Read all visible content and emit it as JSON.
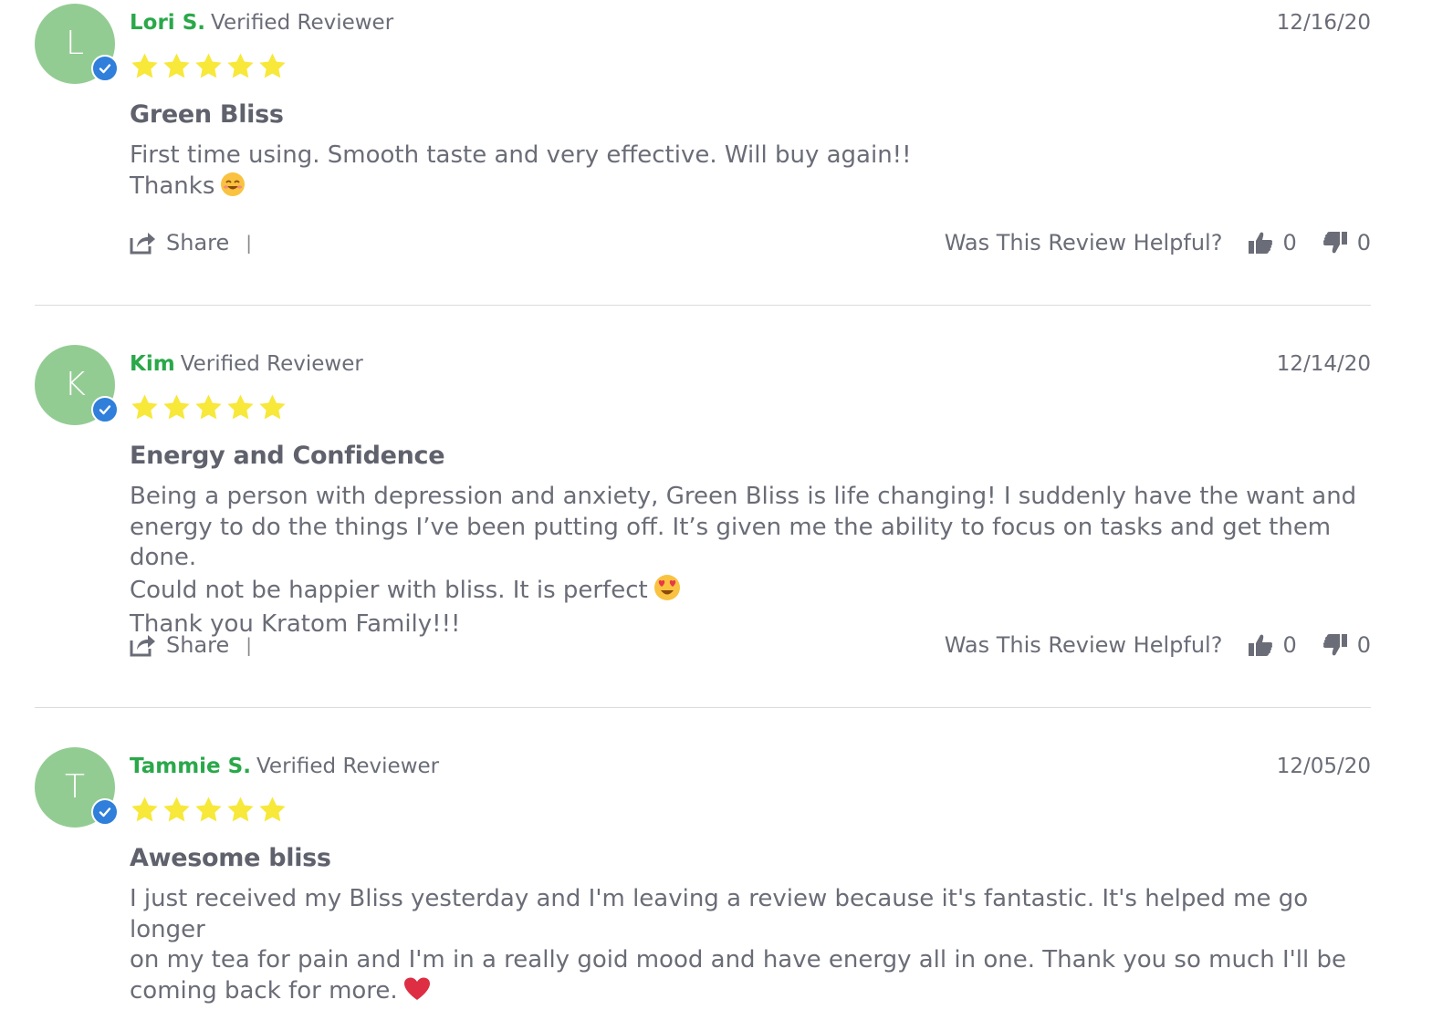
{
  "reviews": [
    {
      "initial": "L",
      "name": "Lori S.",
      "badge": "Verified Reviewer",
      "date": "12/16/20",
      "rating": 5,
      "title": "Green Bliss",
      "body_lines": [
        "First time using. Smooth taste and very effective. Will buy again!!",
        "Thanks"
      ],
      "emoji": "smiling-face-emoji",
      "share_label": "Share",
      "helpful_label": "Was This Review Helpful?",
      "up_count": "0",
      "down_count": "0"
    },
    {
      "initial": "K",
      "name": "Kim",
      "badge": "Verified Reviewer",
      "date": "12/14/20",
      "rating": 5,
      "title": "Energy and Confidence",
      "body_lines": [
        "Being a person with depression and anxiety, Green Bliss is life changing! I suddenly have the want and",
        "energy to do the things I’ve been putting off. It’s given me the ability to focus on tasks and get them done.",
        "Could not be happier with bliss. It is perfect",
        "Thank you Kratom Family!!!"
      ],
      "emoji": "heart-eyes-emoji",
      "share_label": "Share",
      "helpful_label": "Was This Review Helpful?",
      "up_count": "0",
      "down_count": "0"
    },
    {
      "initial": "T",
      "name": "Tammie S.",
      "badge": "Verified Reviewer",
      "date": "12/05/20",
      "rating": 5,
      "title": "Awesome bliss",
      "body_lines": [
        "I just received my Bliss yesterday and I'm leaving a review because it's fantastic. It's helped me go longer",
        "on my tea for pain and I'm in a really goid mood and have energy all in one. Thank you so much I'll be",
        "coming back for more."
      ],
      "emoji": "red-heart-emoji",
      "share_label": "",
      "helpful_label": "",
      "up_count": "",
      "down_count": ""
    }
  ],
  "colors": {
    "name": "#2aa84a",
    "avatar": "#93cc93",
    "badge": "#2f7fdb",
    "star": "#f7e83a",
    "text": "#6a6c77"
  }
}
